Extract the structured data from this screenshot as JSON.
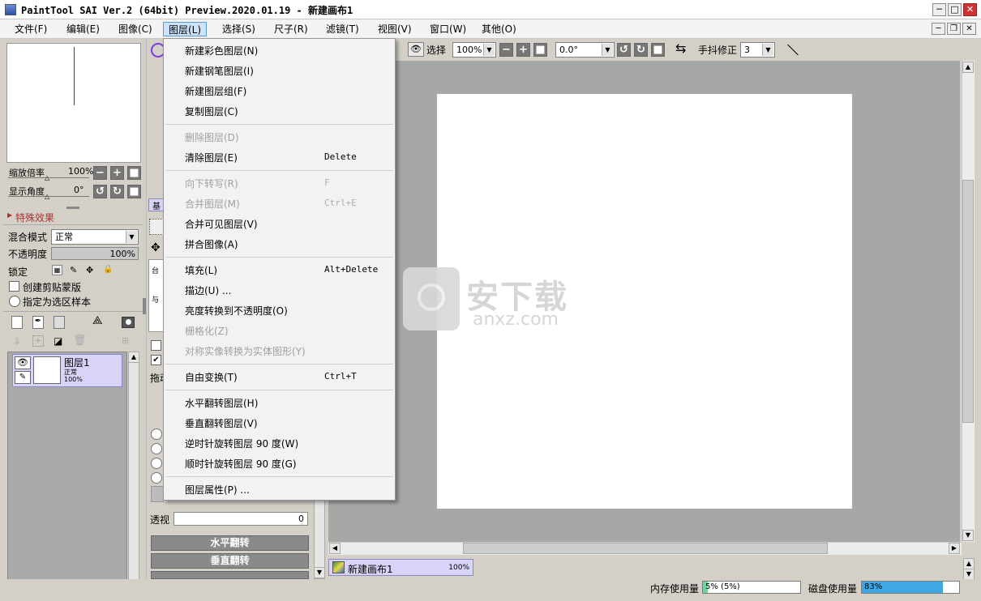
{
  "window": {
    "title": "PaintTool SAI Ver.2 (64bit) Preview.2020.01.19 - 新建画布1",
    "min_glyph": "─",
    "max_glyph": "□",
    "close_glyph": "✕"
  },
  "menubar": {
    "items": [
      {
        "label": "文件(F)"
      },
      {
        "label": "编辑(E)"
      },
      {
        "label": "图像(C)"
      },
      {
        "label": "图层(L)"
      },
      {
        "label": "选择(S)"
      },
      {
        "label": "尺子(R)"
      },
      {
        "label": "滤镜(T)"
      },
      {
        "label": "视图(V)"
      },
      {
        "label": "窗口(W)"
      },
      {
        "label": "其他(O)"
      }
    ]
  },
  "navigator": {
    "zoom_label": "缩放倍率",
    "zoom_value": "100%",
    "angle_label": "显示角度",
    "angle_value": "0°"
  },
  "layer_props": {
    "effects_label": "特殊效果",
    "blend_label": "混合模式",
    "blend_value": "正常",
    "opacity_label": "不透明度",
    "opacity_value": "100%",
    "opacity_fraction": 1.0,
    "lock_label": "锁定",
    "clip_label": "创建剪贴蒙版",
    "sample_label": "指定为选区样本"
  },
  "layers": [
    {
      "name": "图层1",
      "mode": "正常",
      "opacity": "100%"
    }
  ],
  "toolbar": {
    "select_label": "选择",
    "zoom_value": "100%",
    "angle_value": "0.0°",
    "stabilizer_label": "手抖修正",
    "stabilizer_value": "3"
  },
  "layer_menu": {
    "items": [
      {
        "label": "新建彩色图层(N)",
        "shortcut": "",
        "disabled": false
      },
      {
        "label": "新建钢笔图层(I)",
        "shortcut": "",
        "disabled": false
      },
      {
        "label": "新建图层组(F)",
        "shortcut": "",
        "disabled": false
      },
      {
        "label": "复制图层(C)",
        "shortcut": "",
        "disabled": false
      },
      {
        "label": "删除图层(D)",
        "shortcut": "",
        "disabled": true
      },
      {
        "label": "清除图层(E)",
        "shortcut": "Delete",
        "disabled": false
      },
      {
        "label": "向下转写(R)",
        "shortcut": "F",
        "disabled": true
      },
      {
        "label": "合并图层(M)",
        "shortcut": "Ctrl+E",
        "disabled": true
      },
      {
        "label": "合并可见图层(V)",
        "shortcut": "",
        "disabled": false
      },
      {
        "label": "拼合图像(A)",
        "shortcut": "",
        "disabled": false
      },
      {
        "label": "填充(L)",
        "shortcut": "Alt+Delete",
        "disabled": false
      },
      {
        "label": "描边(U) ...",
        "shortcut": "",
        "disabled": false
      },
      {
        "label": "亮度转换到不透明度(O)",
        "shortcut": "",
        "disabled": false
      },
      {
        "label": "栅格化(Z)",
        "shortcut": "",
        "disabled": true
      },
      {
        "label": "对称实像转换为实体图形(Y)",
        "shortcut": "",
        "disabled": true
      },
      {
        "label": "自由变换(T)",
        "shortcut": "Ctrl+T",
        "disabled": false
      },
      {
        "label": "水平翻转图层(H)",
        "shortcut": "",
        "disabled": false
      },
      {
        "label": "垂直翻转图层(V)",
        "shortcut": "",
        "disabled": false
      },
      {
        "label": "逆时针旋转图层 90 度(W)",
        "shortcut": "",
        "disabled": false
      },
      {
        "label": "顺时针旋转图层 90 度(G)",
        "shortcut": "",
        "disabled": false
      },
      {
        "label": "图层属性(P) ...",
        "shortcut": "",
        "disabled": false
      }
    ]
  },
  "tool_panel": {
    "perspective_label": "透视",
    "perspective_value": "0",
    "flip_h": "水平翻转",
    "flip_v": "垂直翻转",
    "drag_label": "拖动",
    "misc1": "台",
    "misc2": "与"
  },
  "canvas_tabs": [
    {
      "name": "新建画布1",
      "zoom": "100%"
    }
  ],
  "status": {
    "mem_label": "内存使用量",
    "mem_text": "5% (5%)",
    "mem_fraction": 0.05,
    "disk_label": "磁盘使用量",
    "disk_text": "83%",
    "disk_fraction": 0.83
  },
  "watermark": {
    "text_cn": "安下载",
    "text_en": "anxz.com"
  },
  "colors": {
    "menu_highlight": "#cde2fb",
    "layer_selected": "#d8d4f8",
    "accent_blue": "#5b9bd5",
    "mem_fill": "#6cd4a0",
    "disk_fill": "#3ea8e4"
  }
}
